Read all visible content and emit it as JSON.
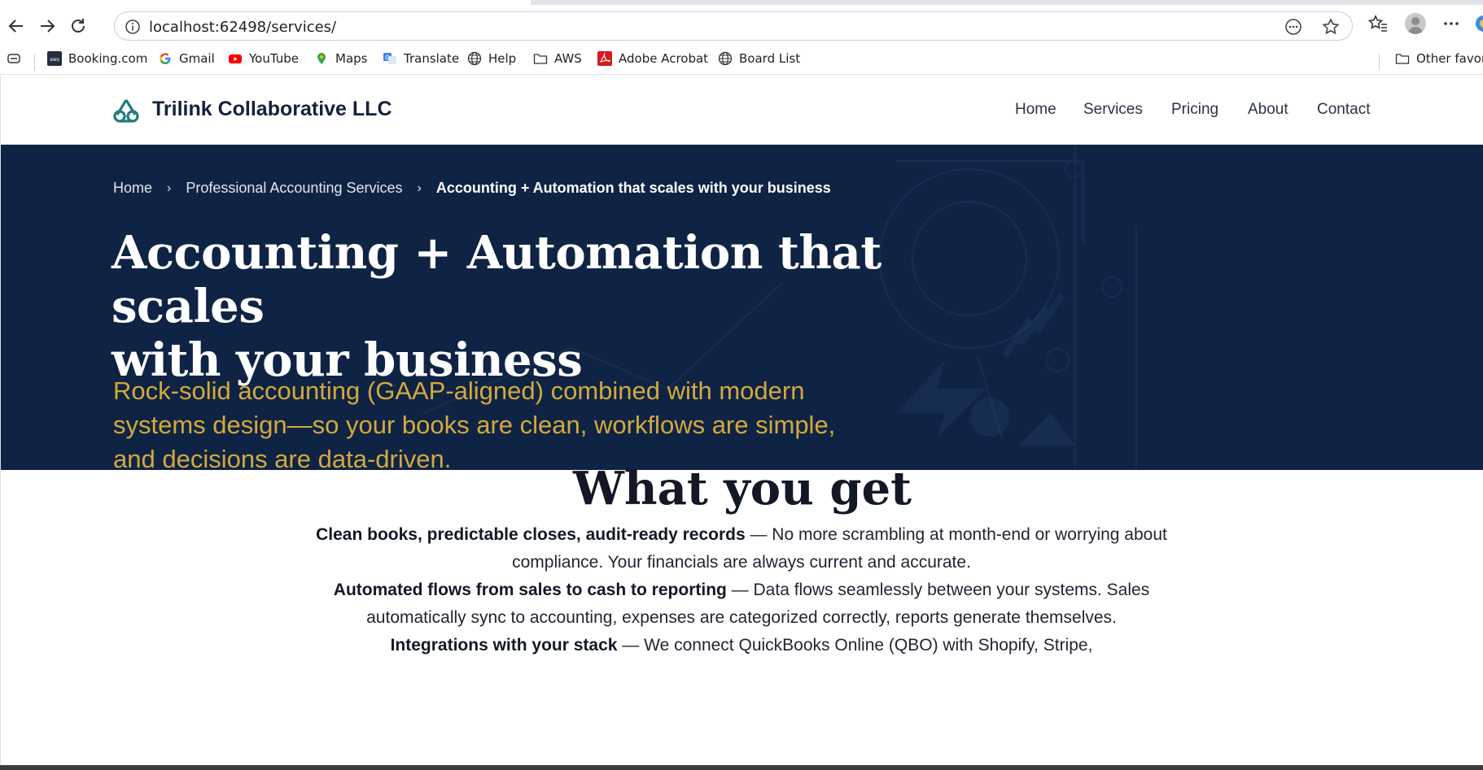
{
  "browser": {
    "url": "localhost:62498/services/"
  },
  "bookmarks": [
    {
      "label": "Booking.com",
      "icon": "booking-icon"
    },
    {
      "label": "Gmail",
      "icon": "google-icon"
    },
    {
      "label": "YouTube",
      "icon": "youtube-icon"
    },
    {
      "label": "Maps",
      "icon": "maps-icon"
    },
    {
      "label": "Translate",
      "icon": "translate-icon"
    },
    {
      "label": "Help",
      "icon": "globe-icon"
    },
    {
      "label": "AWS",
      "icon": "folder-icon"
    },
    {
      "label": "Adobe Acrobat",
      "icon": "acrobat-icon"
    },
    {
      "label": "Board List",
      "icon": "globe-icon"
    }
  ],
  "other_favorites": "Other favorit",
  "site": {
    "brand": "Trilink Collaborative LLC",
    "nav": [
      "Home",
      "Services",
      "Pricing",
      "About",
      "Contact"
    ]
  },
  "hero": {
    "breadcrumb": [
      "Home",
      "Professional Accounting Services",
      "Accounting + Automation that scales with your business"
    ],
    "title_line1": "Accounting + Automation that scales",
    "title_line2": "with your business",
    "subtitle": "Rock-solid accounting (GAAP-aligned) combined with modern systems design—so your books are clean, workflows are simple, and decisions are data-driven."
  },
  "section": {
    "title": "What you get",
    "benefits": [
      {
        "bold": "Clean books, predictable closes, audit-ready records",
        "text": " — No more scrambling at month-end or worrying about compliance. Your financials are always current and accurate."
      },
      {
        "bold": "Automated flows from sales to cash to reporting",
        "text": " — Data flows seamlessly between your systems. Sales automatically sync to accounting, expenses are categorized correctly, reports generate themselves."
      },
      {
        "bold": "Integrations with your stack",
        "text": " — We connect QuickBooks Online (QBO) with Shopify, Stripe,"
      }
    ]
  },
  "colors": {
    "hero_bg": "#0f2445",
    "accent_gold": "#d4a93c",
    "brand_teal": "#1d7d7a"
  }
}
